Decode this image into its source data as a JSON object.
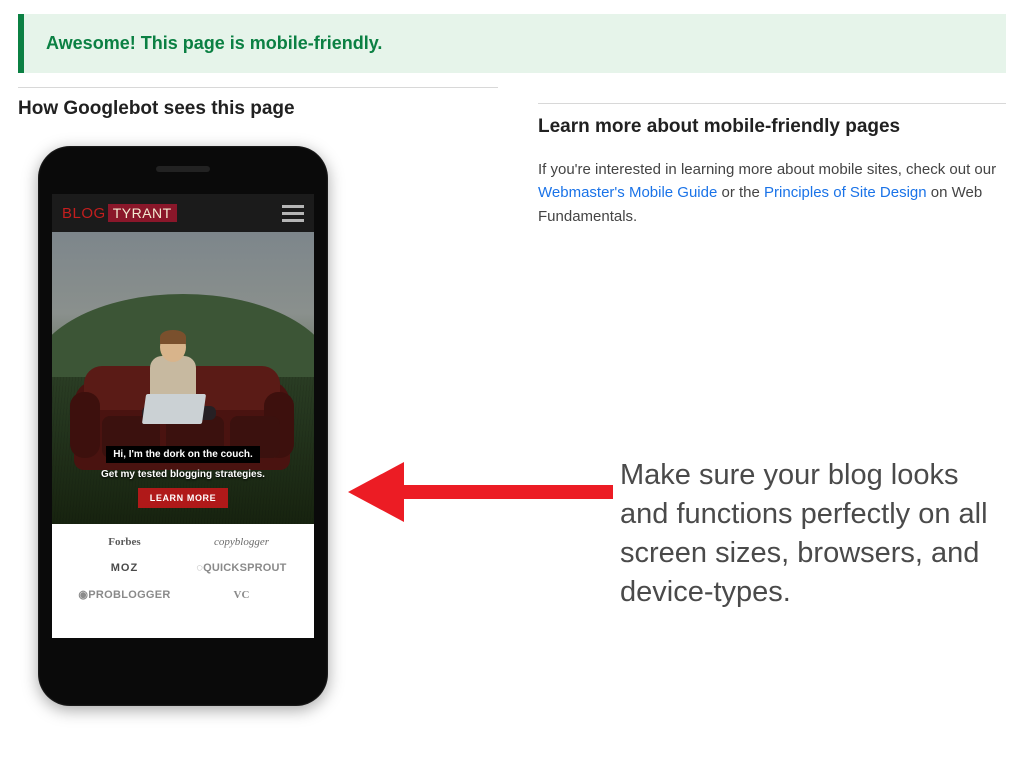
{
  "banner": {
    "message": "Awesome! This page is mobile-friendly."
  },
  "left": {
    "heading": "How Googlebot sees this page"
  },
  "right": {
    "heading": "Learn more about mobile-friendly pages",
    "para_prefix": "If you're interested in learning more about mobile sites, check out our ",
    "link1": "Webmaster's Mobile Guide",
    "para_mid": " or the ",
    "link2": "Principles of Site Design",
    "para_suffix": " on Web Fundamentals."
  },
  "phone": {
    "logo_part1": "BLOG",
    "logo_part2": "TYRANT",
    "tagline1": "Hi, I'm the dork on the couch.",
    "tagline2": "Get my tested blogging strategies.",
    "cta": "LEARN MORE",
    "press_logos": {
      "forbes": "Forbes",
      "copyblogger": "copyblogger",
      "moz": "MOZ",
      "quicksprout": "QUICKSPROUT",
      "problogger": "PROBLOGGER",
      "vc": "VC"
    }
  },
  "annotation": {
    "text": "Make sure your blog looks and functions perfectly on all screen sizes, browsers, and device-types."
  }
}
